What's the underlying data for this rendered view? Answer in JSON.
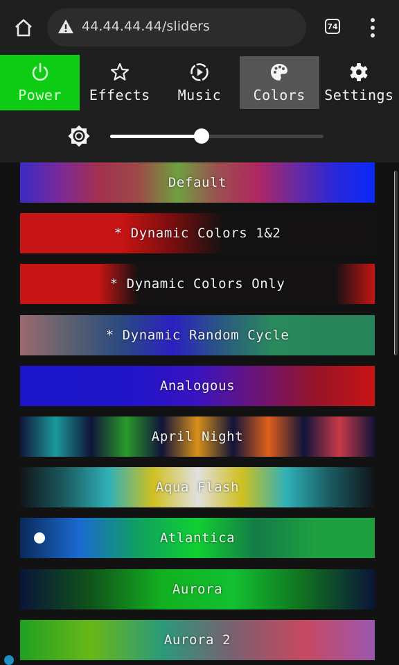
{
  "browser": {
    "url": "44.44.44.44/sliders",
    "tab_count": "74",
    "icons": {
      "home": "home-icon",
      "warning": "warning-triangle-icon",
      "menu": "more-vert-icon"
    }
  },
  "nav": {
    "tabs": [
      {
        "label": "Power",
        "icon": "power-icon",
        "state": "on",
        "color": "#0ecb14"
      },
      {
        "label": "Effects",
        "icon": "star-icon"
      },
      {
        "label": "Music",
        "icon": "play-circle-icon"
      },
      {
        "label": "Colors",
        "icon": "palette-icon",
        "active": true
      },
      {
        "label": "Settings",
        "icon": "gear-icon"
      }
    ]
  },
  "brightness": {
    "icon": "brightness-icon",
    "value_percent": 43
  },
  "palettes": [
    {
      "label": "Default",
      "gradient": [
        "#3b2bc4",
        "#7a2a9a",
        "#a33050",
        "#9c4a48",
        "#6fa040",
        "#9a5050",
        "#b02860",
        "#6a2aa0",
        "#2828d8",
        "#0a28f8"
      ]
    },
    {
      "label": "* Dynamic Colors 1&2",
      "gradient": [
        "#c71414",
        "#c71414",
        "#c71414",
        "#7a0e0e",
        "#141212",
        "#141212",
        "#141212",
        "#141212"
      ]
    },
    {
      "label": "* Dynamic Colors Only",
      "gradient": [
        "#c71414",
        "#c71414",
        "#c71414",
        "#141212",
        "#141212",
        "#141212",
        "#141212",
        "#141212",
        "#141212",
        "#c71414"
      ]
    },
    {
      "label": "* Dynamic Random Cycle",
      "gradient": [
        "#9a6a6e",
        "#5a6070",
        "#2a4a80",
        "#2a20c0",
        "#2a5a80",
        "#2a8a5c",
        "#27845a",
        "#27845a"
      ]
    },
    {
      "label": "Analogous",
      "gradient": [
        "#1c14c8",
        "#1c14c8",
        "#2214c8",
        "#3a14c0",
        "#6a1478",
        "#961428",
        "#c81414"
      ]
    },
    {
      "label": "April Night",
      "gradient": [
        "#10143a",
        "#1a9a9a",
        "#10143a",
        "#2a9a2a",
        "#10143a",
        "#d8901a",
        "#10143a",
        "#e0601a",
        "#10143a",
        "#c83a48",
        "#10143a"
      ]
    },
    {
      "label": "Aqua Flash",
      "gradient": [
        "#101418",
        "#1a5a60",
        "#30b0b8",
        "#d0c020",
        "#e0e0e0",
        "#d0c020",
        "#30b0b8",
        "#1a5a60",
        "#101418"
      ]
    },
    {
      "label": "Atlantica",
      "selected": true,
      "gradient": [
        "#0a2a5a",
        "#1a6ad0",
        "#10a060",
        "#10d030",
        "#157a48",
        "#1ea040",
        "#1ea040"
      ]
    },
    {
      "label": "Aurora",
      "gradient": [
        "#0a1438",
        "#10541a",
        "#12b020",
        "#12c030",
        "#107020",
        "#0a1438"
      ]
    },
    {
      "label": "Aurora 2",
      "gradient": [
        "#20a020",
        "#68b818",
        "#2a9a7a",
        "#7a6070",
        "#c84860",
        "#9a58b0"
      ]
    }
  ]
}
